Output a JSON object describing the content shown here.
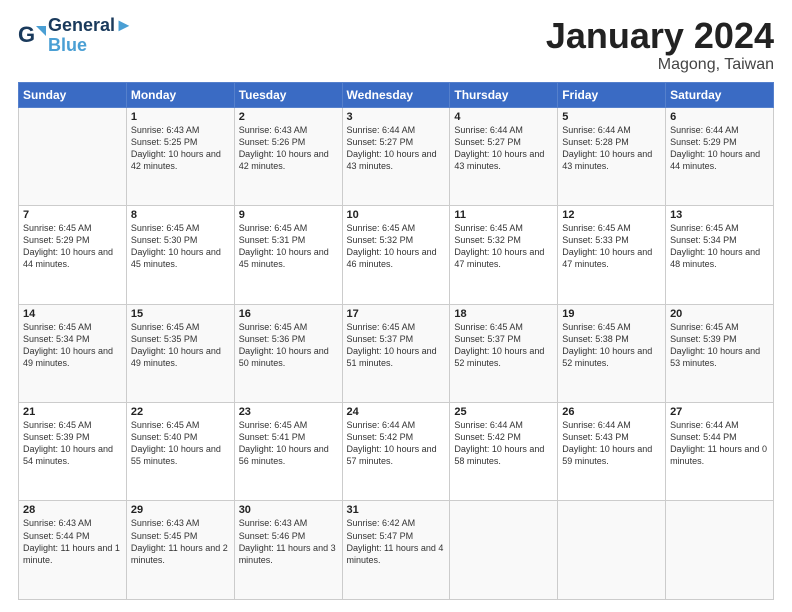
{
  "header": {
    "logo_line1": "General",
    "logo_line2": "Blue",
    "month": "January 2024",
    "location": "Magong, Taiwan"
  },
  "days_of_week": [
    "Sunday",
    "Monday",
    "Tuesday",
    "Wednesday",
    "Thursday",
    "Friday",
    "Saturday"
  ],
  "weeks": [
    [
      {
        "day": "",
        "sunrise": "",
        "sunset": "",
        "daylight": ""
      },
      {
        "day": "1",
        "sunrise": "Sunrise: 6:43 AM",
        "sunset": "Sunset: 5:25 PM",
        "daylight": "Daylight: 10 hours and 42 minutes."
      },
      {
        "day": "2",
        "sunrise": "Sunrise: 6:43 AM",
        "sunset": "Sunset: 5:26 PM",
        "daylight": "Daylight: 10 hours and 42 minutes."
      },
      {
        "day": "3",
        "sunrise": "Sunrise: 6:44 AM",
        "sunset": "Sunset: 5:27 PM",
        "daylight": "Daylight: 10 hours and 43 minutes."
      },
      {
        "day": "4",
        "sunrise": "Sunrise: 6:44 AM",
        "sunset": "Sunset: 5:27 PM",
        "daylight": "Daylight: 10 hours and 43 minutes."
      },
      {
        "day": "5",
        "sunrise": "Sunrise: 6:44 AM",
        "sunset": "Sunset: 5:28 PM",
        "daylight": "Daylight: 10 hours and 43 minutes."
      },
      {
        "day": "6",
        "sunrise": "Sunrise: 6:44 AM",
        "sunset": "Sunset: 5:29 PM",
        "daylight": "Daylight: 10 hours and 44 minutes."
      }
    ],
    [
      {
        "day": "7",
        "sunrise": "Sunrise: 6:45 AM",
        "sunset": "Sunset: 5:29 PM",
        "daylight": "Daylight: 10 hours and 44 minutes."
      },
      {
        "day": "8",
        "sunrise": "Sunrise: 6:45 AM",
        "sunset": "Sunset: 5:30 PM",
        "daylight": "Daylight: 10 hours and 45 minutes."
      },
      {
        "day": "9",
        "sunrise": "Sunrise: 6:45 AM",
        "sunset": "Sunset: 5:31 PM",
        "daylight": "Daylight: 10 hours and 45 minutes."
      },
      {
        "day": "10",
        "sunrise": "Sunrise: 6:45 AM",
        "sunset": "Sunset: 5:32 PM",
        "daylight": "Daylight: 10 hours and 46 minutes."
      },
      {
        "day": "11",
        "sunrise": "Sunrise: 6:45 AM",
        "sunset": "Sunset: 5:32 PM",
        "daylight": "Daylight: 10 hours and 47 minutes."
      },
      {
        "day": "12",
        "sunrise": "Sunrise: 6:45 AM",
        "sunset": "Sunset: 5:33 PM",
        "daylight": "Daylight: 10 hours and 47 minutes."
      },
      {
        "day": "13",
        "sunrise": "Sunrise: 6:45 AM",
        "sunset": "Sunset: 5:34 PM",
        "daylight": "Daylight: 10 hours and 48 minutes."
      }
    ],
    [
      {
        "day": "14",
        "sunrise": "Sunrise: 6:45 AM",
        "sunset": "Sunset: 5:34 PM",
        "daylight": "Daylight: 10 hours and 49 minutes."
      },
      {
        "day": "15",
        "sunrise": "Sunrise: 6:45 AM",
        "sunset": "Sunset: 5:35 PM",
        "daylight": "Daylight: 10 hours and 49 minutes."
      },
      {
        "day": "16",
        "sunrise": "Sunrise: 6:45 AM",
        "sunset": "Sunset: 5:36 PM",
        "daylight": "Daylight: 10 hours and 50 minutes."
      },
      {
        "day": "17",
        "sunrise": "Sunrise: 6:45 AM",
        "sunset": "Sunset: 5:37 PM",
        "daylight": "Daylight: 10 hours and 51 minutes."
      },
      {
        "day": "18",
        "sunrise": "Sunrise: 6:45 AM",
        "sunset": "Sunset: 5:37 PM",
        "daylight": "Daylight: 10 hours and 52 minutes."
      },
      {
        "day": "19",
        "sunrise": "Sunrise: 6:45 AM",
        "sunset": "Sunset: 5:38 PM",
        "daylight": "Daylight: 10 hours and 52 minutes."
      },
      {
        "day": "20",
        "sunrise": "Sunrise: 6:45 AM",
        "sunset": "Sunset: 5:39 PM",
        "daylight": "Daylight: 10 hours and 53 minutes."
      }
    ],
    [
      {
        "day": "21",
        "sunrise": "Sunrise: 6:45 AM",
        "sunset": "Sunset: 5:39 PM",
        "daylight": "Daylight: 10 hours and 54 minutes."
      },
      {
        "day": "22",
        "sunrise": "Sunrise: 6:45 AM",
        "sunset": "Sunset: 5:40 PM",
        "daylight": "Daylight: 10 hours and 55 minutes."
      },
      {
        "day": "23",
        "sunrise": "Sunrise: 6:45 AM",
        "sunset": "Sunset: 5:41 PM",
        "daylight": "Daylight: 10 hours and 56 minutes."
      },
      {
        "day": "24",
        "sunrise": "Sunrise: 6:44 AM",
        "sunset": "Sunset: 5:42 PM",
        "daylight": "Daylight: 10 hours and 57 minutes."
      },
      {
        "day": "25",
        "sunrise": "Sunrise: 6:44 AM",
        "sunset": "Sunset: 5:42 PM",
        "daylight": "Daylight: 10 hours and 58 minutes."
      },
      {
        "day": "26",
        "sunrise": "Sunrise: 6:44 AM",
        "sunset": "Sunset: 5:43 PM",
        "daylight": "Daylight: 10 hours and 59 minutes."
      },
      {
        "day": "27",
        "sunrise": "Sunrise: 6:44 AM",
        "sunset": "Sunset: 5:44 PM",
        "daylight": "Daylight: 11 hours and 0 minutes."
      }
    ],
    [
      {
        "day": "28",
        "sunrise": "Sunrise: 6:43 AM",
        "sunset": "Sunset: 5:44 PM",
        "daylight": "Daylight: 11 hours and 1 minute."
      },
      {
        "day": "29",
        "sunrise": "Sunrise: 6:43 AM",
        "sunset": "Sunset: 5:45 PM",
        "daylight": "Daylight: 11 hours and 2 minutes."
      },
      {
        "day": "30",
        "sunrise": "Sunrise: 6:43 AM",
        "sunset": "Sunset: 5:46 PM",
        "daylight": "Daylight: 11 hours and 3 minutes."
      },
      {
        "day": "31",
        "sunrise": "Sunrise: 6:42 AM",
        "sunset": "Sunset: 5:47 PM",
        "daylight": "Daylight: 11 hours and 4 minutes."
      },
      {
        "day": "",
        "sunrise": "",
        "sunset": "",
        "daylight": ""
      },
      {
        "day": "",
        "sunrise": "",
        "sunset": "",
        "daylight": ""
      },
      {
        "day": "",
        "sunrise": "",
        "sunset": "",
        "daylight": ""
      }
    ]
  ]
}
